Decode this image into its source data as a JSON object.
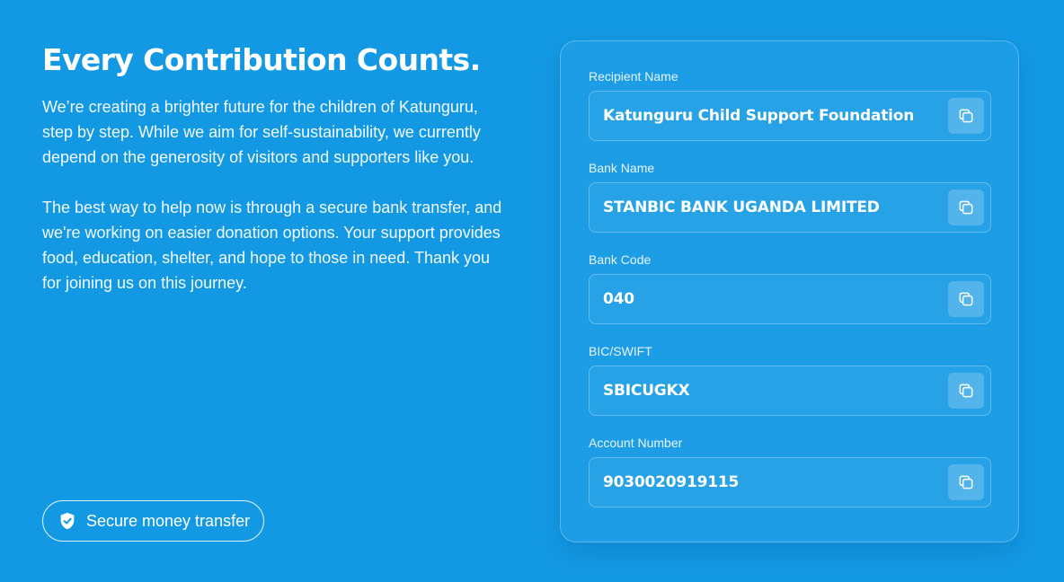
{
  "intro": {
    "title": "Every Contribution Counts.",
    "paragraph1": "We’re creating a brighter future for the children of Katunguru, step by step. While we aim for self-sustainability, we currently depend on the generosity of visitors and supporters like you.",
    "paragraph2": "The best way to help now is through a secure bank transfer, and we're working on easier donation options. Your support provides food, education, shelter, and hope to those in need. Thank you for joining us on this journey."
  },
  "badge": {
    "icon": "shield-check-icon",
    "label": "Secure money transfer"
  },
  "bank_details": {
    "copy_icon": "copy-icon",
    "fields": [
      {
        "label": "Recipient Name",
        "value": "Katunguru Child Support Foundation"
      },
      {
        "label": "Bank Name",
        "value": "STANBIC BANK UGANDA LIMITED"
      },
      {
        "label": "Bank Code",
        "value": "040"
      },
      {
        "label": "BIC/SWIFT",
        "value": "SBICUGKX"
      },
      {
        "label": "Account Number",
        "value": "9030020919115"
      }
    ]
  },
  "colors": {
    "background": "#1399e4",
    "text": "#ffffff"
  }
}
